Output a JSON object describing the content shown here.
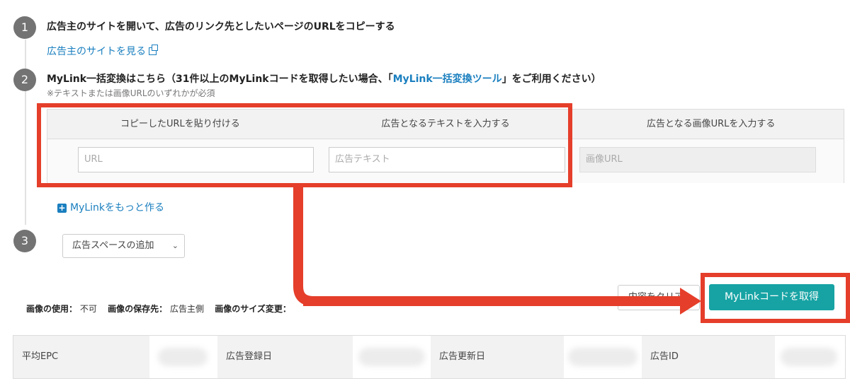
{
  "steps": [
    {
      "number": "1",
      "title": "広告主のサイトを開いて、広告のリンク先としたいページのURLをコピーする",
      "link": "広告主のサイトを見る"
    },
    {
      "number": "2",
      "title_prefix": "MyLink一括変換はこちら（31件以上のMyLinkコードを取得したい場合、「",
      "title_link": "MyLink一括変換ツール",
      "title_suffix": "」をご利用ください）",
      "note": "※テキストまたは画像URLのいずれかが必須"
    },
    {
      "number": "3"
    }
  ],
  "form": {
    "headers": [
      "コピーしたURLを貼り付ける",
      "広告となるテキストを入力する",
      "広告となる画像URLを入力する"
    ],
    "placeholders": {
      "url": "URL",
      "text": "広告テキスト",
      "image": "画像URL"
    },
    "add_more": "MyLinkをもっと作る"
  },
  "ad_space_select": "広告スペースの追加",
  "meta": {
    "usage_label": "画像の使用：",
    "usage_value": "不可",
    "storage_label": "画像の保存先：",
    "storage_value": "広告主側",
    "resize_label": "画像のサイズ変更："
  },
  "buttons": {
    "clear": "内容をクリア",
    "get_code": "MyLinkコードを取得"
  },
  "info_table": {
    "labels": [
      "平均EPC",
      "広告登録日",
      "広告更新日",
      "広告ID"
    ]
  },
  "colors": {
    "accent_red": "#e53e2a",
    "teal": "#17a3a4",
    "link_blue": "#1a7fbf",
    "step_gray": "#737373"
  },
  "icons": {
    "external": "external-link-icon",
    "plus": "plus-square-icon",
    "chevron": "chevron-down-icon"
  }
}
